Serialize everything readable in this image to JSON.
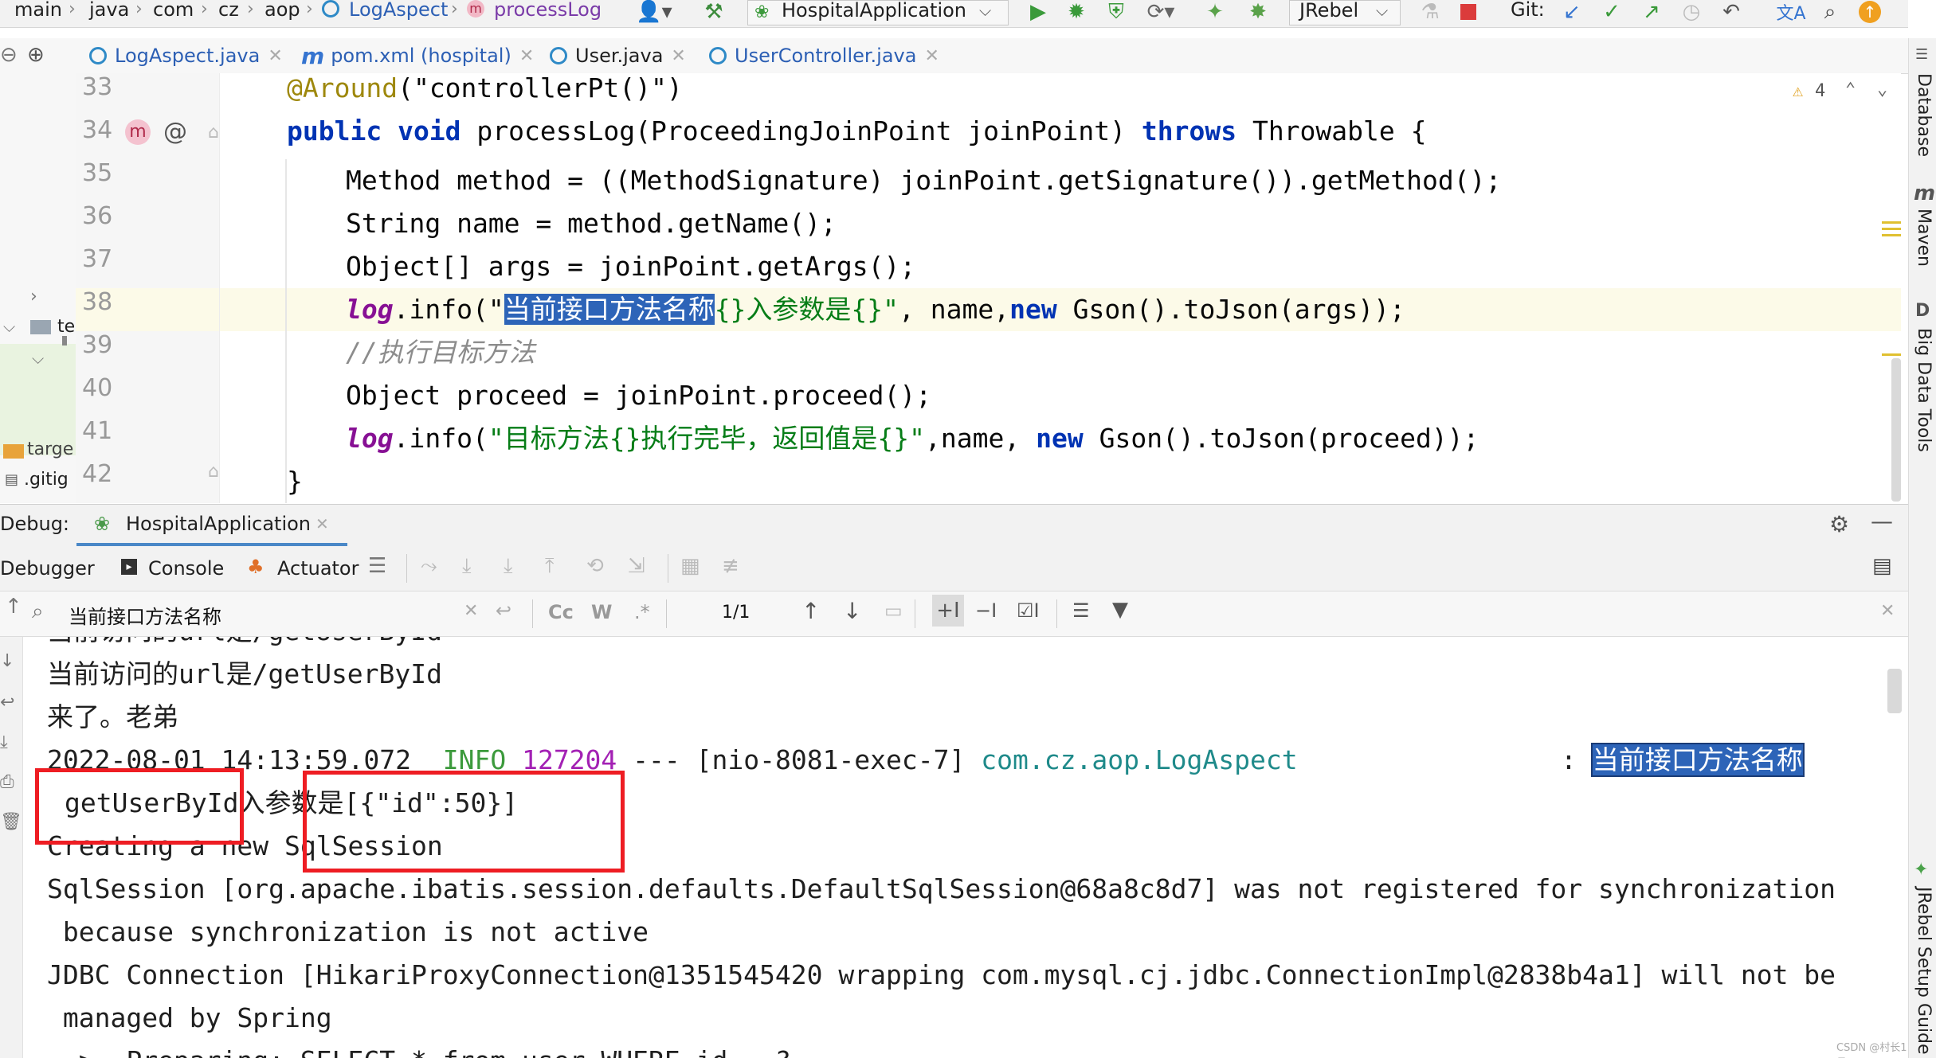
{
  "breadcrumb": {
    "items": [
      "main",
      "java",
      "com",
      "cz",
      "aop",
      "LogAspect",
      "processLog"
    ]
  },
  "toolbar": {
    "run_config": "HospitalApplication",
    "jrebel": "JRebel",
    "git_label": "Git:"
  },
  "editor_tabs": [
    {
      "label": "LogAspect.java"
    },
    {
      "label": "pom.xml (hospital)"
    },
    {
      "label": "User.java"
    },
    {
      "label": "UserController.java"
    }
  ],
  "project_stub": {
    "items": [
      "te",
      "targe",
      ".gitig"
    ]
  },
  "editor": {
    "line_numbers": [
      "33",
      "34",
      "35",
      "36",
      "37",
      "38",
      "39",
      "40",
      "41",
      "42"
    ],
    "warnings_count": "4",
    "lines": {
      "l33": {
        "ann": "@Around",
        "rest": "(\"controllerPt()\")"
      },
      "l34": {
        "kw1": "public void",
        "mid": " processLog(ProceedingJoinPoint joinPoint) ",
        "kw2": "throws",
        "end": " Throwable {"
      },
      "l35": "Method method = ((MethodSignature) joinPoint.getSignature()).getMethod();",
      "l36": "String name = method.getName();",
      "l37": "Object[] args = joinPoint.getArgs();",
      "l38": {
        "log": "log",
        "pre": ".info(\"",
        "hl": "当前接口方法名称",
        "str": "{}入参数是{}\"",
        "mid": ", name,",
        "kw": "new",
        "end": " Gson().toJson(args));"
      },
      "l39": "//执行目标方法",
      "l40": "Object proceed = joinPoint.proceed();",
      "l41": {
        "log": "log",
        "pre": ".info(",
        "str": "\"目标方法{}执行完毕，返回值是{}\"",
        "mid": ",name, ",
        "kw": "new",
        "end": " Gson().toJson(proceed));"
      },
      "l42": "}"
    }
  },
  "right_tools": [
    "Database",
    "Maven",
    "Big Data Tools",
    "JRebel Setup Guide"
  ],
  "debug": {
    "label": "Debug:",
    "session_tab": "HospitalApplication",
    "subtabs": [
      "Debugger",
      "Console",
      "Actuator"
    ]
  },
  "search": {
    "query": "当前接口方法名称",
    "match_count": "1/1",
    "case_label": "Cc",
    "word_label": "W",
    "regex_label": ".*"
  },
  "console": {
    "lines": {
      "c0": "当前访问的url是/getUserById",
      "c1": "当前访问的url是/getUserById",
      "c2": "来了。老弟",
      "c3_time": "2022-08-01 14:13:59.072",
      "c3_level": "INFO",
      "c3_pid": "127204",
      "c3_thread": " --- [nio-8081-exec-7] ",
      "c3_class": "com.cz.aop.LogAspect",
      "c3_colon": ": ",
      "c3_hl": "当前接口方法名称",
      "c4": "getUserById入参数是[{\"id\":50}]",
      "c5": "Creating a new SqlSession",
      "c6": "SqlSession [org.apache.ibatis.session.defaults.DefaultSqlSession@68a8c8d7] was not registered for synchronization",
      "c7": " because synchronization is not active",
      "c8": "JDBC Connection [HikariProxyConnection@1351545420 wrapping com.mysql.cj.jdbc.ConnectionImpl@2838b4a1] will not be",
      "c9": " managed by Spring",
      "c10": "==>  Preparing: SELECT * from user WHERE id = ?"
    }
  },
  "watermark": "CSDN @村长1号",
  "colors": {
    "keyword": "#0033b3",
    "string": "#067d17",
    "annotation": "#9e880d",
    "highlight": "#2d64b8",
    "red_box": "#ee1d23"
  }
}
